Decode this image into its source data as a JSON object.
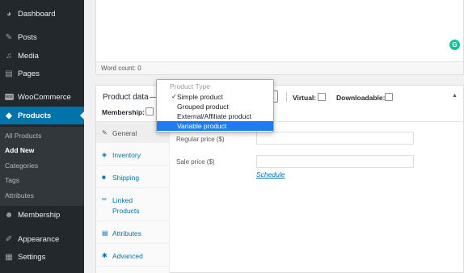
{
  "sidebar": {
    "items": [
      {
        "id": "dashboard",
        "label": "Dashboard",
        "icon": "dashboard-icon"
      },
      {
        "id": "posts",
        "label": "Posts",
        "icon": "pin-icon"
      },
      {
        "id": "media",
        "label": "Media",
        "icon": "media-icon"
      },
      {
        "id": "pages",
        "label": "Pages",
        "icon": "pages-icon"
      },
      {
        "id": "woocommerce",
        "label": "WooCommerce",
        "icon": "woo-icon"
      },
      {
        "id": "products",
        "label": "Products",
        "icon": "products-icon"
      },
      {
        "id": "membership",
        "label": "Membership",
        "icon": "membership-icon"
      },
      {
        "id": "appearance",
        "label": "Appearance",
        "icon": "appearance-icon"
      },
      {
        "id": "settings",
        "label": "Settings",
        "icon": "settings-icon"
      }
    ],
    "submenu": [
      "All Products",
      "Add New",
      "Categories",
      "Tags",
      "Attributes"
    ],
    "accent": "#0073aa"
  },
  "editor": {
    "word_count": "Word count: 0"
  },
  "product_data": {
    "title": "Product data",
    "dash": "—",
    "virtual_label": "Virtual:",
    "downloadable_label": "Downloadable:",
    "membership_label": "Membership:",
    "tabs": [
      "General",
      "Inventory",
      "Shipping",
      "Linked Products",
      "Attributes",
      "Advanced"
    ],
    "regular_price_label": "Regular price ($)",
    "sale_price_label": "Sale price ($)",
    "schedule_link": "Schedule"
  },
  "dropdown": {
    "group_label": "Product Type",
    "options": [
      "Simple product",
      "Grouped product",
      "External/Affiliate product",
      "Variable product"
    ],
    "checked": "Simple product",
    "highlighted": "Variable product",
    "highlight_color": "#1f7cf0"
  }
}
